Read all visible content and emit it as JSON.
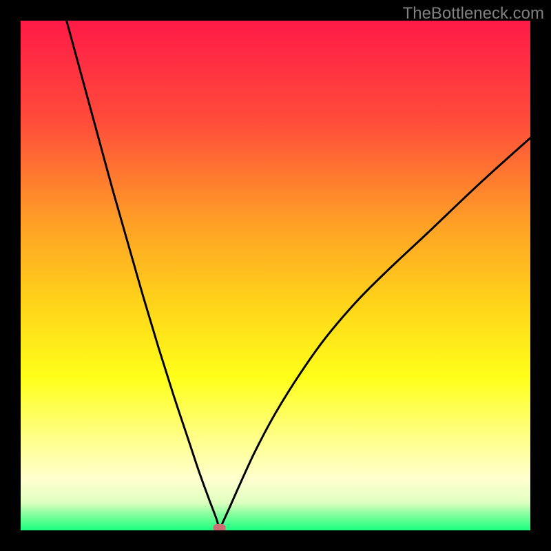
{
  "watermark": "TheBottleneck.com",
  "colors": {
    "black": "#000000",
    "curve": "#000000",
    "marker": "#c77172",
    "gradient_stops": [
      {
        "offset": 0.0,
        "color": "#ff1a47"
      },
      {
        "offset": 0.2,
        "color": "#ff4d3a"
      },
      {
        "offset": 0.4,
        "color": "#ffa126"
      },
      {
        "offset": 0.55,
        "color": "#ffd21a"
      },
      {
        "offset": 0.7,
        "color": "#ffff1a"
      },
      {
        "offset": 0.82,
        "color": "#ffff8a"
      },
      {
        "offset": 0.9,
        "color": "#ffffd0"
      },
      {
        "offset": 0.945,
        "color": "#e0ffc0"
      },
      {
        "offset": 0.97,
        "color": "#80ff9a"
      },
      {
        "offset": 1.0,
        "color": "#1aff80"
      }
    ]
  },
  "chart_data": {
    "type": "line",
    "title": "",
    "xlabel": "",
    "ylabel": "",
    "xlim": [
      0,
      100
    ],
    "ylim": [
      0,
      100
    ],
    "note": "Bottleneck resonance-style curve. y≈0 at x≈39 (the marker); y rises steeply either side. Left branch reaches y=100 at x≈9, right branch reaches y≈77 at x=100.",
    "series": [
      {
        "name": "curve",
        "x": [
          9,
          12,
          15,
          18,
          21,
          24,
          27,
          30,
          33,
          35,
          37,
          38.5,
          39,
          39.5,
          41,
          43,
          46,
          50,
          55,
          60,
          66,
          72,
          80,
          90,
          100
        ],
        "y": [
          100,
          89,
          78,
          67,
          56.5,
          46,
          36,
          26.5,
          17.5,
          11.5,
          6,
          2,
          0,
          1.2,
          4.5,
          9,
          15.5,
          23,
          31,
          38,
          45,
          51,
          58.5,
          68,
          77
        ]
      }
    ],
    "marker": {
      "x": 39,
      "y": 0
    }
  }
}
